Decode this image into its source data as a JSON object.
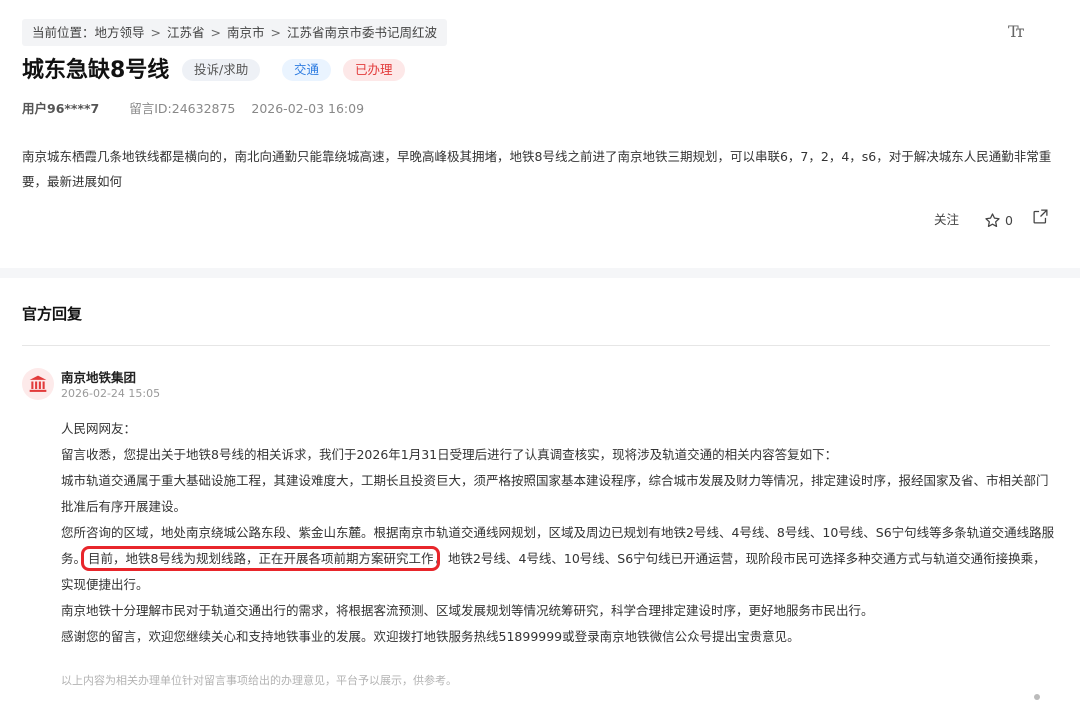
{
  "breadcrumb": {
    "prefix": "当前位置：",
    "items": [
      "地方领导",
      "江苏省",
      "南京市",
      "江苏省南京市委书记周红波"
    ],
    "separator": ">"
  },
  "font_size_toggle": "Tт",
  "post": {
    "title": "城东急缺8号线",
    "tags": {
      "type": "投诉/求助",
      "field": "交通",
      "status": "已办理"
    },
    "user": "用户96****7",
    "message_id": "留言ID:24632875",
    "datetime": "2026-02-03 16:09",
    "content": "南京城东栖霞几条地铁线都是横向的，南北向通勤只能靠绕城高速，早晚高峰极其拥堵，地铁8号线之前进了南京地铁三期规划，可以串联6，7，2，4，s6，对于解决城东人民通勤非常重要，最新进展如何",
    "follow_label": "关注",
    "star_count": "0"
  },
  "reply": {
    "header": "官方回复",
    "org_name": "南京地铁集团",
    "time": "2026-02-24 15:05",
    "greeting": "人民网网友：",
    "p1": "留言收悉，您提出关于地铁8号线的相关诉求，我们于2026年1月31日受理后进行了认真调查核实，现将涉及轨道交通的相关内容答复如下：",
    "p2": "城市轨道交通属于重大基础设施工程，其建设难度大，工期长且投资巨大，须严格按照国家基本建设程序，综合城市发展及财力等情况，排定建设时序，报经国家及省、市相关部门批准后有序开展建设。",
    "p3_before": "您所咨询的区域，地处南京绕城公路东段、紫金山东麓。根据南京市轨道交通线网规划，区域及周边已规划有地铁2号线、4号线、8号线、10号线、S6宁句线等多条轨道交通线路服务。",
    "p3_highlight": "目前，地铁8号线为规划线路，正在开展各项前期方案研究工作",
    "p3_after": "。地铁2号线、4号线、10号线、S6宁句线已开通运营，现阶段市民可选择多种交通方式与轨道交通衔接换乘，实现便捷出行。",
    "p4": "南京地铁十分理解市民对于轨道交通出行的需求，将根据客流预测、区域发展规划等情况统筹研究，科学合理排定建设时序，更好地服务市民出行。",
    "p5": "感谢您的留言，欢迎您继续关心和支持地铁事业的发展。欢迎拨打地铁服务热线51899999或登录南京地铁微信公众号提出宝贵意见。",
    "footnote": "以上内容为相关办理单位针对留言事项给出的办理意见，平台予以展示，供参考。"
  },
  "icons": {
    "star": "star-outline-icon",
    "share": "share-icon",
    "avatar": "government-building-icon",
    "font_size": "font-size-icon"
  },
  "colors": {
    "status_red": "#e23b3b",
    "field_blue": "#2f7de1",
    "highlight_border": "#e8262b"
  }
}
